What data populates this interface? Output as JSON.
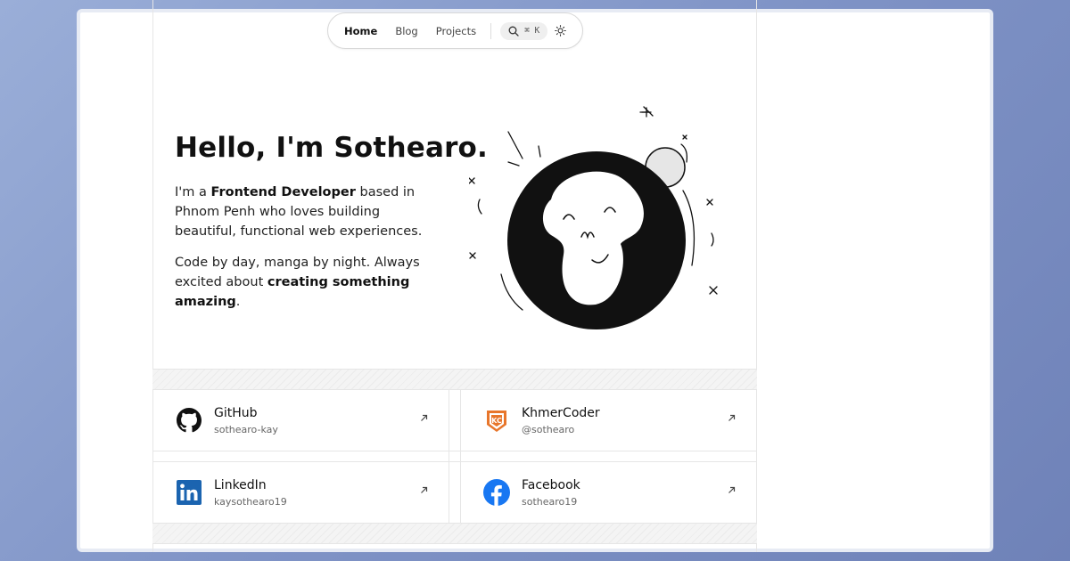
{
  "nav": {
    "links": [
      {
        "label": "Home",
        "active": true
      },
      {
        "label": "Blog",
        "active": false
      },
      {
        "label": "Projects",
        "active": false
      }
    ],
    "search_shortcut": "⌘ K",
    "icons": [
      "search-icon",
      "sun-icon"
    ]
  },
  "hero": {
    "title": "Hello, I'm Sothearo.",
    "p1_pre": "I'm a ",
    "p1_bold": "Frontend Developer",
    "p1_post": " based in Phnom Penh who loves building beautiful, functional web experiences.",
    "p2_pre": "Code by day, manga by night. Always excited about ",
    "p2_bold": "creating something amazing",
    "p2_post": "."
  },
  "avatar": {
    "icon": "monkey-avatar-illustration"
  },
  "socials": [
    {
      "name": "GitHub",
      "handle": "sothearo-kay",
      "icon": "github-icon",
      "color": "#111111"
    },
    {
      "name": "KhmerCoder",
      "handle": "@sothearo",
      "icon": "khmercoder-icon",
      "color": "#e8762b"
    },
    {
      "name": "LinkedIn",
      "handle": "kaysothearo19",
      "icon": "linkedin-icon",
      "color": "#1b64b0"
    },
    {
      "name": "Facebook",
      "handle": "sothearo19",
      "icon": "facebook-icon",
      "color": "#1877f2"
    }
  ],
  "colors": {
    "background": "#8ea2d0",
    "text": "#111111"
  }
}
